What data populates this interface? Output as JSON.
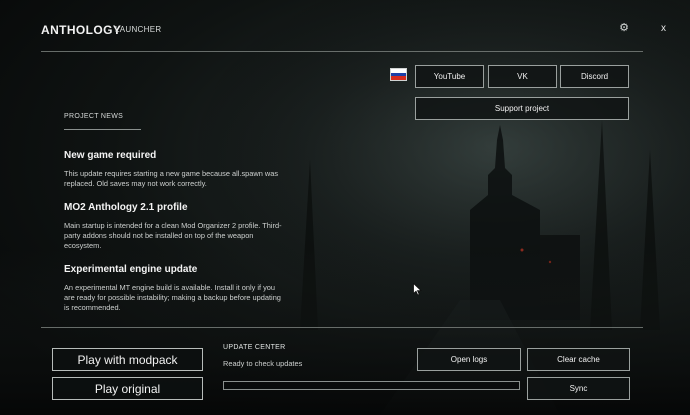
{
  "app": {
    "title": "ANTHOLOGY",
    "subtitle": "LAUNCHER"
  },
  "window_controls": {
    "settings_glyph": "⚙",
    "close_glyph": "x"
  },
  "flag": {
    "stripes": [
      "#ffffff",
      "#1c3fa8",
      "#d52b1e"
    ]
  },
  "links": {
    "youtube": "YouTube",
    "vk": "VK",
    "discord": "Discord",
    "support": "Support project"
  },
  "news": {
    "header": "PROJECT NEWS",
    "items": [
      {
        "title": "New game required",
        "body": "This update requires starting a new game because all.spawn was replaced. Old saves may not work correctly."
      },
      {
        "title": "MO2 Anthology 2.1 profile",
        "body": "Main startup is intended for a clean Mod Organizer 2 profile. Third-party addons should not be installed on top of the weapon ecosystem."
      },
      {
        "title": "Experimental engine update",
        "body": "An experimental MT engine build is available. Install it only if you are ready for possible instability; making a backup before updating is recommended."
      }
    ]
  },
  "play": {
    "modpack": "Play with modpack",
    "original": "Play original"
  },
  "update_center": {
    "header": "UPDATE CENTER",
    "status": "Ready to check updates",
    "progress": 0
  },
  "actions": {
    "open_logs": "Open logs",
    "clear_cache": "Clear cache",
    "sync": "Sync"
  },
  "colors": {
    "accent": "#5f8f7a",
    "border": "#9aa09e",
    "background": "#0b0d0d"
  }
}
